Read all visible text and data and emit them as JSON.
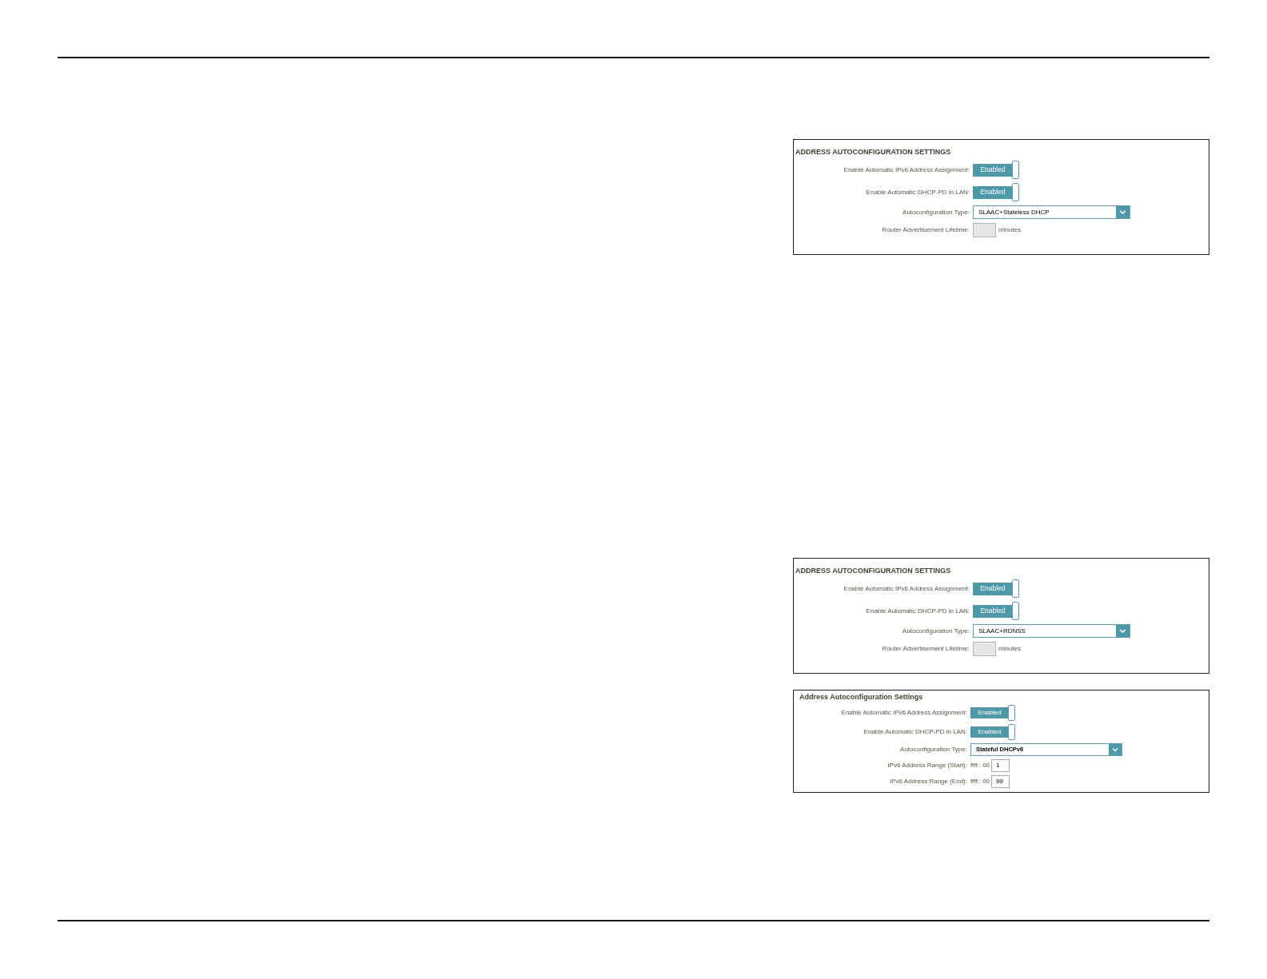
{
  "panels": [
    {
      "title": "ADDRESS AUTOCONFIGURATION SETTINGS",
      "rows": [
        {
          "kind": "toggle",
          "label": "Enable Automatic IPv6 Address Assignment:",
          "on": true,
          "text": "Enabled"
        },
        {
          "kind": "toggle",
          "label": "Enable Automatic DHCP-PD in LAN:",
          "on": true,
          "text": "Enabled"
        },
        {
          "kind": "select",
          "label": "Autoconfiguration Type:",
          "value": "SLAAC+Stateless DHCP"
        },
        {
          "kind": "number",
          "label": "Router Advertisement Lifetime:",
          "disabled": true,
          "unit": "minutes"
        }
      ]
    },
    {
      "title": "ADDRESS AUTOCONFIGURATION SETTINGS",
      "rows": [
        {
          "kind": "toggle",
          "label": "Enable Automatic IPv6 Address Assignment:",
          "on": true,
          "text": "Enabled"
        },
        {
          "kind": "toggle",
          "label": "Enable Automatic DHCP-PD in LAN:",
          "on": true,
          "text": "Enabled"
        },
        {
          "kind": "select",
          "label": "Autoconfiguration Type:",
          "value": "SLAAC+RDNSS"
        },
        {
          "kind": "number",
          "label": "Router Advertisement Lifetime:",
          "disabled": true,
          "unit": "minutes"
        }
      ]
    },
    {
      "title": "Address Autoconfiguration Settings",
      "rows": [
        {
          "kind": "toggle",
          "label": "Enable Automatic IPv6 Address Assignment:",
          "on": true,
          "text": "Enabled"
        },
        {
          "kind": "toggle",
          "label": "Enable Automatic DHCP-PD in LAN:",
          "on": true,
          "text": "Enabled"
        },
        {
          "kind": "select",
          "label": "Autoconfiguration Type:",
          "value": "Stateful DHCPv6"
        },
        {
          "kind": "range",
          "label": "IPv6 Address Range (Start):",
          "prefix": "ffff:: 00",
          "value": "1"
        },
        {
          "kind": "range",
          "label": "IPv6 Address Range (End):",
          "prefix": "ffff:: 00",
          "value": "99"
        }
      ]
    }
  ]
}
